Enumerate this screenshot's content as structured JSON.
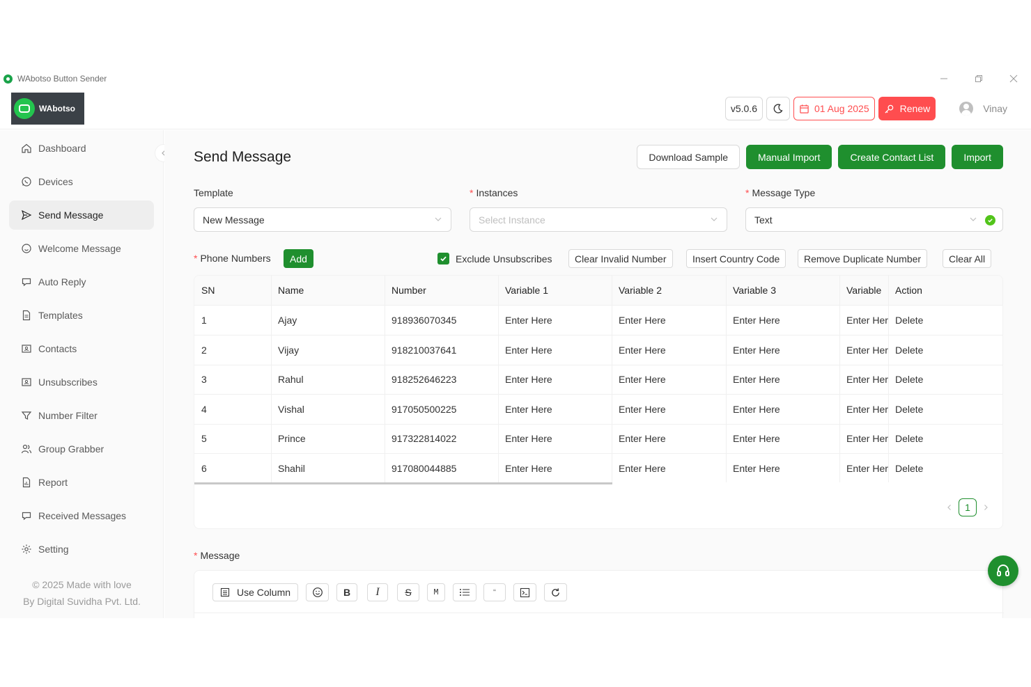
{
  "window": {
    "title": "WAbotso Button Sender"
  },
  "header": {
    "logo_text": "WAbotso",
    "version": "v5.0.6",
    "expiry_date": "01 Aug 2025",
    "renew_label": "Renew",
    "user_name": "Vinay"
  },
  "sidebar": {
    "items": [
      {
        "label": "Dashboard",
        "icon": "home-icon"
      },
      {
        "label": "Devices",
        "icon": "whatsapp-icon"
      },
      {
        "label": "Send Message",
        "icon": "send-icon",
        "active": true
      },
      {
        "label": "Welcome Message",
        "icon": "smile-icon"
      },
      {
        "label": "Auto Reply",
        "icon": "chat-icon"
      },
      {
        "label": "Templates",
        "icon": "file-icon"
      },
      {
        "label": "Contacts",
        "icon": "contacts-icon"
      },
      {
        "label": "Unsubscribes",
        "icon": "contacts-icon"
      },
      {
        "label": "Number Filter",
        "icon": "filter-icon"
      },
      {
        "label": "Group Grabber",
        "icon": "users-icon"
      },
      {
        "label": "Report",
        "icon": "report-icon"
      },
      {
        "label": "Received Messages",
        "icon": "chat-icon"
      },
      {
        "label": "Setting",
        "icon": "gear-icon"
      }
    ],
    "footer_line1": "© 2025 Made with love",
    "footer_line2": "By Digital Suvidha Pvt. Ltd."
  },
  "main": {
    "title": "Send Message",
    "actions": {
      "download_sample": "Download Sample",
      "manual_import": "Manual Import",
      "create_contact_list": "Create Contact List",
      "import": "Import"
    },
    "template": {
      "label": "Template",
      "value": "New Message"
    },
    "instances": {
      "label": "Instances",
      "placeholder": "Select Instance"
    },
    "message_type": {
      "label": "Message Type",
      "value": "Text"
    },
    "phone_numbers": {
      "label": "Phone Numbers",
      "add_label": "Add",
      "exclude_label": "Exclude Unsubscribes",
      "exclude_checked": true,
      "clear_invalid": "Clear Invalid Number",
      "insert_country": "Insert Country Code",
      "remove_duplicate": "Remove Duplicate Number",
      "clear_all": "Clear All"
    },
    "table": {
      "columns": [
        "SN",
        "Name",
        "Number",
        "Variable 1",
        "Variable 2",
        "Variable 3",
        "Variable",
        "Action"
      ],
      "rows": [
        {
          "sn": "1",
          "name": "Ajay",
          "number": "918936070345",
          "v1": "Enter Here",
          "v2": "Enter Here",
          "v3": "Enter Here",
          "v4": "Enter Here",
          "action": "Delete"
        },
        {
          "sn": "2",
          "name": "Vijay",
          "number": "918210037641",
          "v1": "Enter Here",
          "v2": "Enter Here",
          "v3": "Enter Here",
          "v4": "Enter Here",
          "action": "Delete"
        },
        {
          "sn": "3",
          "name": "Rahul",
          "number": "918252646223",
          "v1": "Enter Here",
          "v2": "Enter Here",
          "v3": "Enter Here",
          "v4": "Enter Here",
          "action": "Delete"
        },
        {
          "sn": "4",
          "name": "Vishal",
          "number": "917050500225",
          "v1": "Enter Here",
          "v2": "Enter Here",
          "v3": "Enter Here",
          "v4": "Enter Here",
          "action": "Delete"
        },
        {
          "sn": "5",
          "name": "Prince",
          "number": "917322814022",
          "v1": "Enter Here",
          "v2": "Enter Here",
          "v3": "Enter Here",
          "v4": "Enter Here",
          "action": "Delete"
        },
        {
          "sn": "6",
          "name": "Shahil",
          "number": "917080044885",
          "v1": "Enter Here",
          "v2": "Enter Here",
          "v3": "Enter Here",
          "v4": "Enter Here",
          "action": "Delete"
        }
      ],
      "current_page": "1"
    },
    "message": {
      "label": "Message",
      "use_column_label": "Use Column",
      "bold": "B",
      "italic": "I",
      "strike": "S",
      "mono": "M",
      "quote": "“"
    }
  },
  "colors": {
    "accent_green": "#1f8f2e",
    "danger_red": "#ff4d4f",
    "logo_bg": "#3b4147"
  }
}
